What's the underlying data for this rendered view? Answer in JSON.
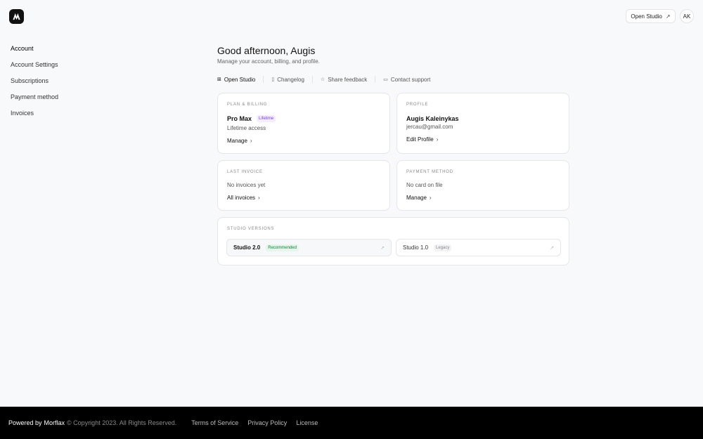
{
  "header": {
    "open_studio_label": "Open Studio",
    "avatar_initials": "AK"
  },
  "sidebar": {
    "items": [
      {
        "label": "Account"
      },
      {
        "label": "Account Settings"
      },
      {
        "label": "Subscriptions"
      },
      {
        "label": "Payment method"
      },
      {
        "label": "Invoices"
      }
    ]
  },
  "main": {
    "greeting": "Good afternoon, Augis",
    "subtitle": "Manage your account, billing, and profile.",
    "quicklinks": [
      {
        "label": "Open Studio",
        "icon": "grid-icon"
      },
      {
        "label": "Changelog",
        "icon": "document-icon"
      },
      {
        "label": "Share feedback",
        "icon": "star-icon"
      },
      {
        "label": "Contact support",
        "icon": "chat-icon"
      }
    ]
  },
  "plan": {
    "label": "PLAN & BILLING",
    "name": "Pro Max",
    "badge": "Lifetime",
    "access": "Lifetime access",
    "link": "Manage"
  },
  "profile": {
    "label": "PROFILE",
    "name": "Augis Kaleinykas",
    "email": "jercau@gmail.com",
    "link": "Edit Profile"
  },
  "invoice": {
    "label": "LAST INVOICE",
    "status": "No invoices yet",
    "link": "All invoices"
  },
  "payment": {
    "label": "PAYMENT METHOD",
    "status": "No card on file",
    "link": "Manage"
  },
  "versions": {
    "label": "STUDIO VERSIONS",
    "items": [
      {
        "name": "Studio 2.0",
        "badge": "Recommended"
      },
      {
        "name": "Studio 1.0",
        "badge": "Legacy"
      }
    ]
  },
  "footer": {
    "powered": "Powered by",
    "brand": "Morflax",
    "copyright": "© Copyright 2023. All Rights Reserved.",
    "links": [
      {
        "label": "Terms of Service"
      },
      {
        "label": "Privacy Policy"
      },
      {
        "label": "License"
      }
    ]
  },
  "colors": {
    "background": "#f8f9fb",
    "footer": "#000000",
    "lifetime_badge": "#7c3aed",
    "recommended_badge": "#15803d"
  }
}
